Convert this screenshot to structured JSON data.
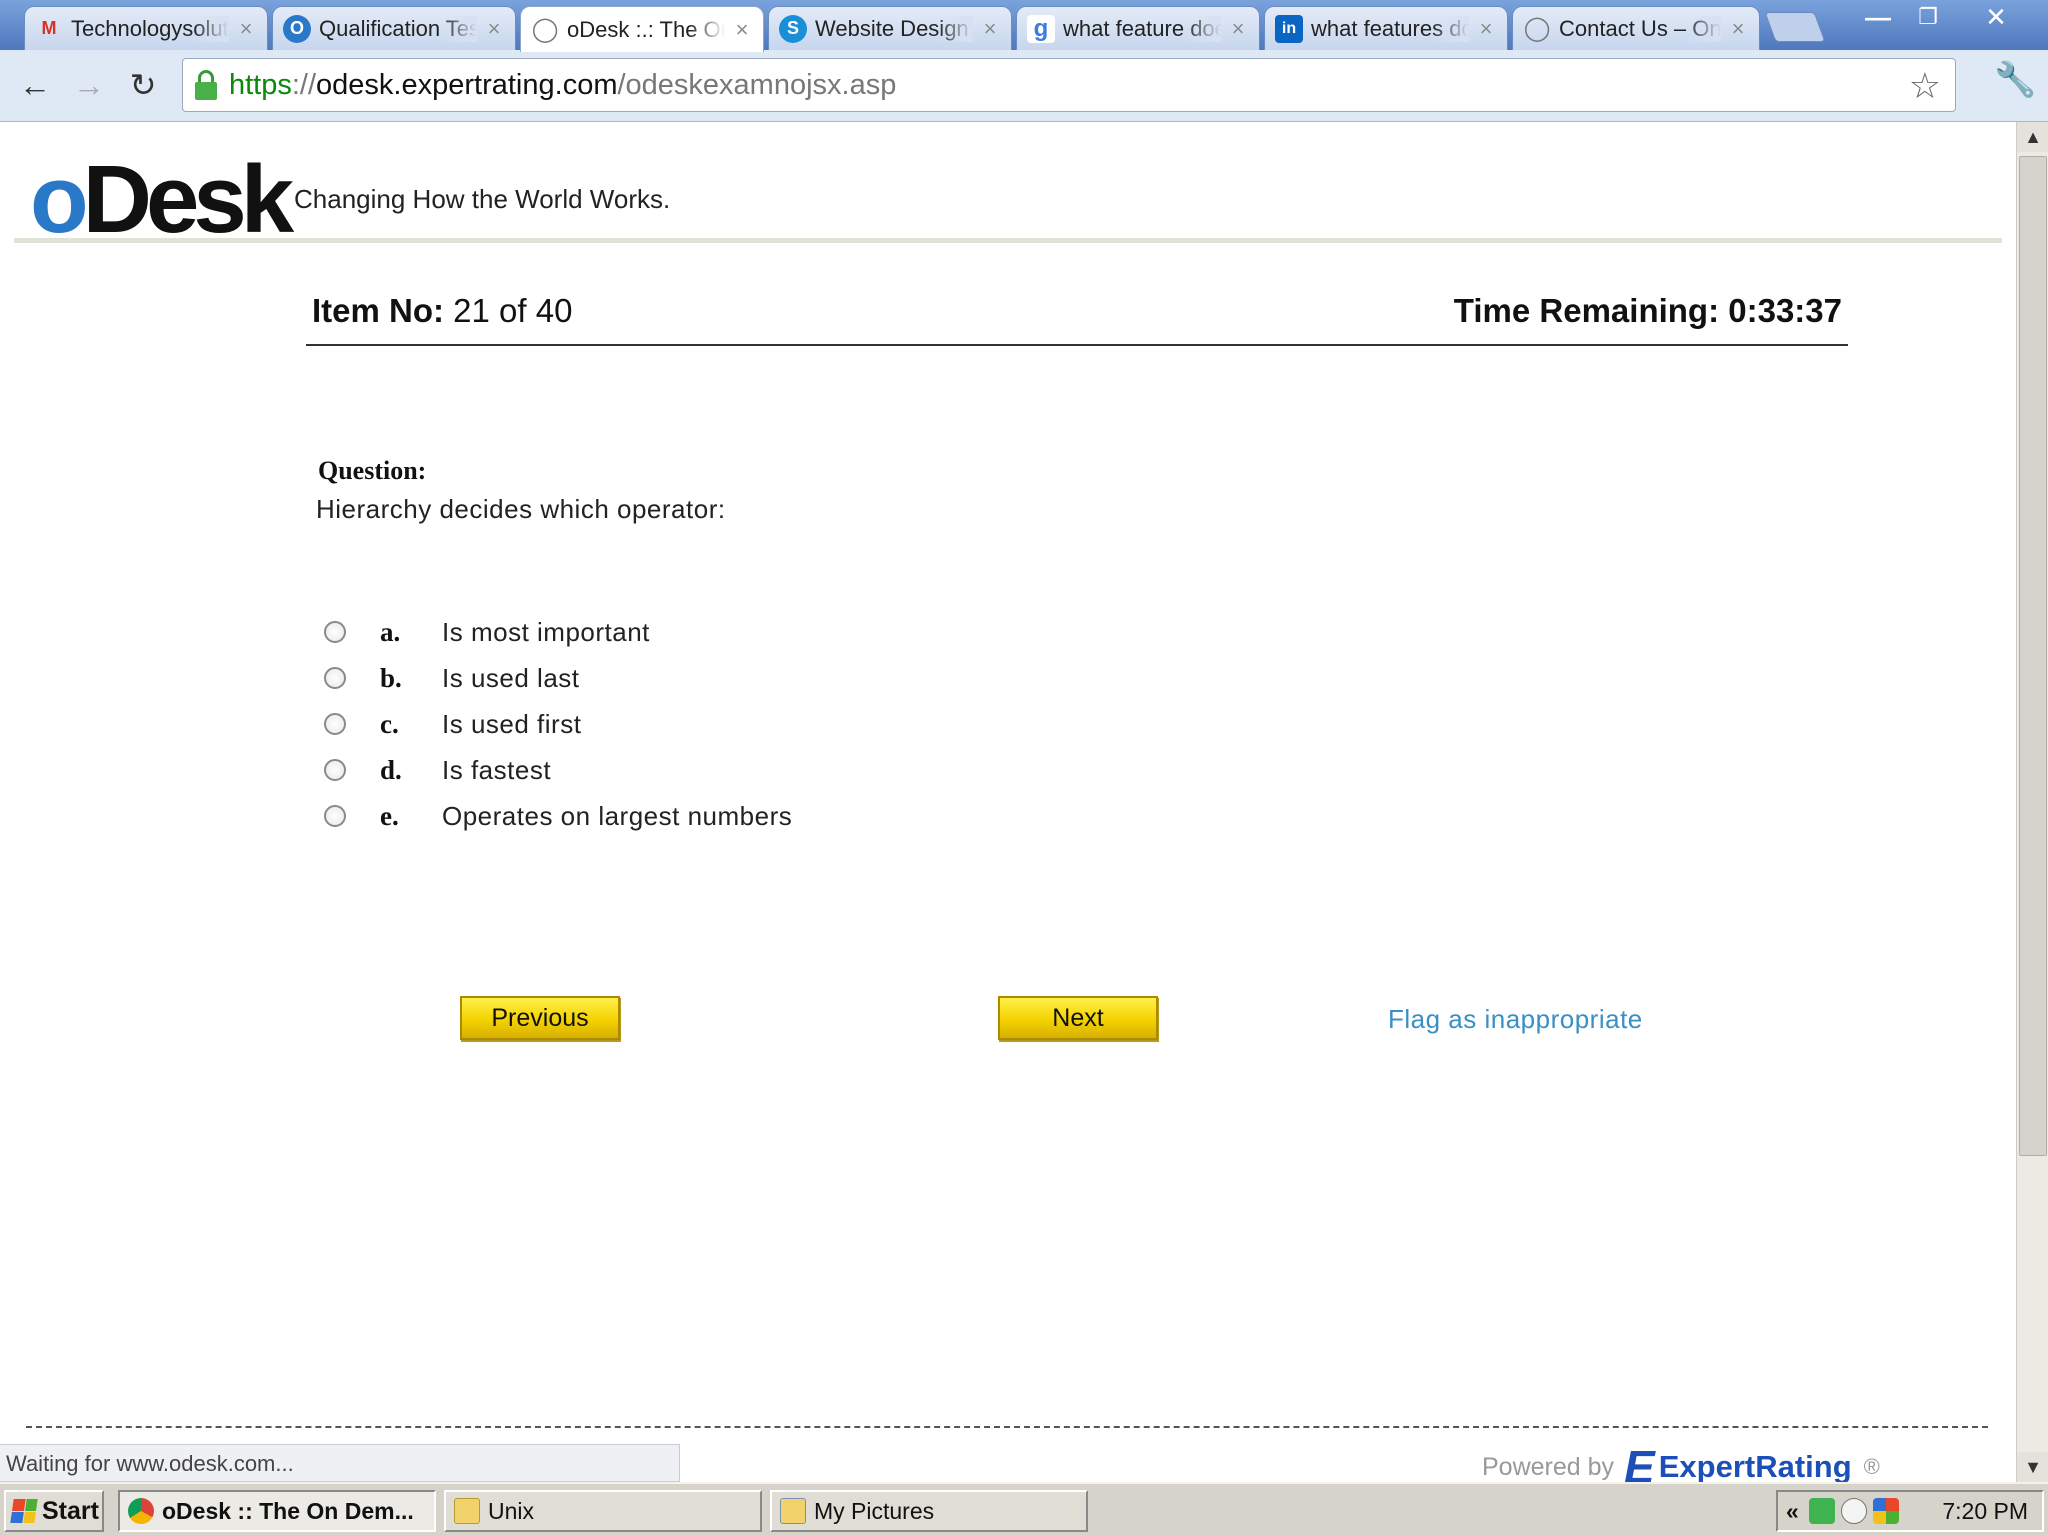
{
  "browser": {
    "tabs": [
      {
        "title": "Technologysolution",
        "icon": "gmail-icon",
        "icon_glyph": "M",
        "icon_color": "#d93025",
        "active": false
      },
      {
        "title": "Qualification Test",
        "icon": "odesk-tab-icon",
        "icon_glyph": "O",
        "icon_color": "#2a78c8",
        "active": false
      },
      {
        "title": "oDesk :.: The On Demand",
        "icon": "globe-icon",
        "icon_glyph": "◯",
        "icon_color": "#777777",
        "active": true
      },
      {
        "title": "Website Design,",
        "icon": "skype-icon",
        "icon_glyph": "S",
        "icon_color": "#1a8fd8",
        "active": false
      },
      {
        "title": "what feature does",
        "icon": "google-icon",
        "icon_glyph": "g",
        "icon_color": "#3c7be0",
        "active": false
      },
      {
        "title": "what features do",
        "icon": "linkedin-icon",
        "icon_glyph": "in",
        "icon_color": "#0a66c2",
        "active": false
      },
      {
        "title": "Contact Us – Online",
        "icon": "globe-icon",
        "icon_glyph": "◯",
        "icon_color": "#777777",
        "active": false
      }
    ],
    "url": {
      "scheme": "https",
      "separator": "://",
      "host": "odesk.expertrating.com",
      "path": "/odeskexamnojsx.asp"
    },
    "status_text": "Waiting for www.odesk.com..."
  },
  "page": {
    "logo": {
      "o": "o",
      "rest": "Desk"
    },
    "tagline": "Changing How the World Works.",
    "item": {
      "label": "Item No:",
      "value": "21 of 40"
    },
    "time": {
      "label": "Time Remaining:",
      "value": "0:33:37"
    },
    "question_label": "Question:",
    "question_text": "Hierarchy decides which operator:",
    "options": [
      {
        "letter": "a.",
        "text": "Is most important"
      },
      {
        "letter": "b.",
        "text": "Is used last"
      },
      {
        "letter": "c.",
        "text": "Is used first"
      },
      {
        "letter": "d.",
        "text": "Is fastest"
      },
      {
        "letter": "e.",
        "text": "Operates on largest numbers"
      }
    ],
    "previous_label": "Previous",
    "next_label": "Next",
    "flag_label": "Flag as inappropriate",
    "powered_by": "Powered by",
    "expertrating_mark": "E",
    "expertrating_name": "ExpertRating",
    "registered": "®"
  },
  "taskbar": {
    "start_label": "Start",
    "tasks": [
      {
        "label": "oDesk :: The On Dem...",
        "active": true
      },
      {
        "label": "Unix",
        "active": false
      },
      {
        "label": "My Pictures",
        "active": false
      }
    ],
    "tray_chevron": "«",
    "clock": "7:20 PM"
  }
}
